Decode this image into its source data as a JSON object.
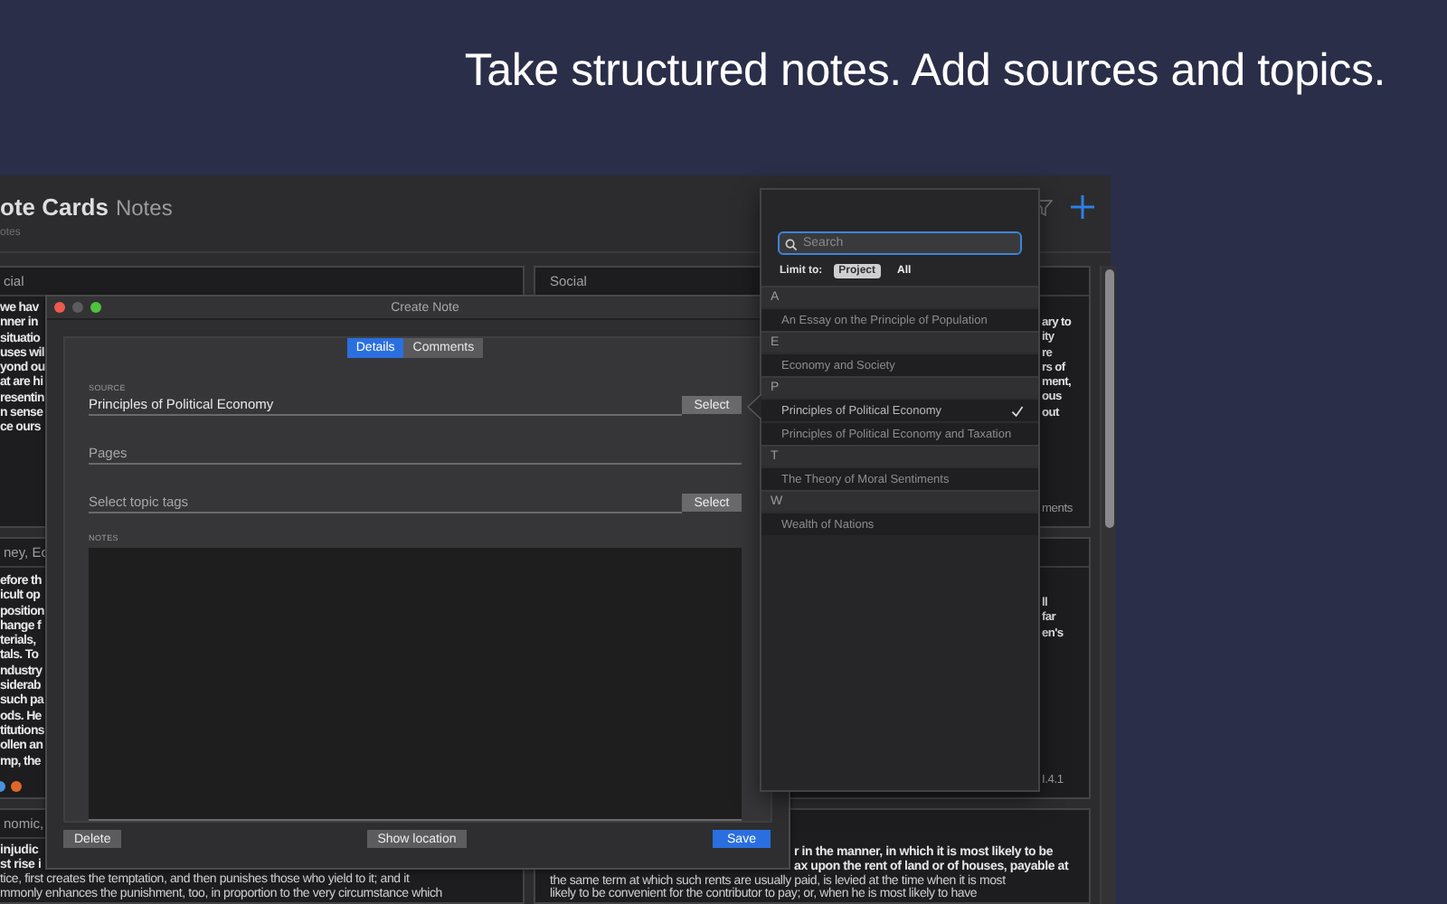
{
  "headline": "Take structured notes. Add sources and topics.",
  "app": {
    "title": "ote Cards",
    "view": "Notes",
    "subtitle": "otes"
  },
  "left_cards": [
    {
      "header": "cial",
      "lines": [
        "we hav",
        "nner in",
        "situatio",
        "uses wil",
        "yond ou",
        "at are hi",
        "resentin",
        "n sense",
        "ce ours"
      ]
    },
    {
      "header": "ney, Ec",
      "lines": [
        "efore th",
        "icult op",
        "position",
        "hange f",
        "terials,",
        "tals. To",
        "ndustry",
        "siderab",
        "such pa",
        "ods. He",
        "titutions",
        "ollen an",
        "mp, the"
      ],
      "tags": [
        {
          "color": "#4a8fe0"
        },
        {
          "color": "#e0672a"
        }
      ]
    },
    {
      "header": "nomic,",
      "lines": [
        "injudic",
        "st rise i",
        "tice, first creates the temptation, and then punishes those who yield to it; and it",
        "mmonly enhances the punishment, too, in proportion to the very circumstance which"
      ]
    }
  ],
  "right_cards": [
    {
      "header": "Social",
      "lines": [
        "ary to",
        "ity",
        "re",
        "rs of",
        "ment,",
        "ous",
        "out"
      ],
      "footer": "ments"
    },
    {
      "lines": [
        "ll",
        "far",
        "en's"
      ],
      "footer": "I.4.1"
    }
  ],
  "right_bottom_card": {
    "partial_lines": [
      "r in the manner, in which it is most likely to be",
      "ax upon the rent of land or of houses, payable at"
    ],
    "lines": [
      "the same term at which such rents are usually paid, is levied at the time when it is most",
      "likely to be convenient for the contributor to pay; or, when he is most likely to have"
    ]
  },
  "dialog": {
    "title": "Create Note",
    "tabs": [
      {
        "label": "Details",
        "selected": true
      },
      {
        "label": "Comments",
        "selected": false
      }
    ],
    "source_label": "SOURCE",
    "source_value": "Principles of Political Economy",
    "source_button": "Select",
    "pages_placeholder": "Pages",
    "tags_placeholder": "Select topic tags",
    "tags_button": "Select",
    "notes_label": "NOTES",
    "buttons": {
      "delete": "Delete",
      "location": "Show location",
      "save": "Save"
    }
  },
  "popover": {
    "search_placeholder": "Search",
    "limit_label": "Limit to:",
    "limit_options": [
      {
        "label": "Project",
        "selected": true
      },
      {
        "label": "All",
        "selected": false
      }
    ],
    "sections": [
      {
        "letter": "A",
        "items": [
          {
            "title": "An Essay on the Principle of Population",
            "selected": false
          }
        ]
      },
      {
        "letter": "E",
        "items": [
          {
            "title": "Economy and Society",
            "selected": false
          }
        ]
      },
      {
        "letter": "P",
        "items": [
          {
            "title": "Principles of Political Economy",
            "selected": true
          },
          {
            "title": "Principles of Political Economy and Taxation",
            "selected": false
          }
        ]
      },
      {
        "letter": "T",
        "items": [
          {
            "title": "The Theory of Moral Sentiments",
            "selected": false
          }
        ]
      },
      {
        "letter": "W",
        "items": [
          {
            "title": "Wealth of Nations",
            "selected": false
          }
        ]
      }
    ]
  }
}
